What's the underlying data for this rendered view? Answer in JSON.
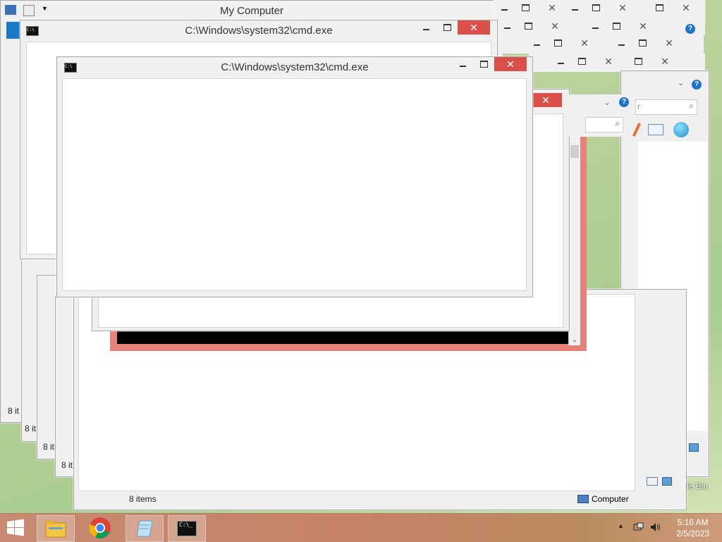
{
  "windows": {
    "explorer": {
      "title": "My Computer",
      "status_items": "8 items",
      "status_items_short": "8 it",
      "status_computer": "Computer",
      "status_computer_partial": "uter",
      "search_partial": "r"
    },
    "cmd_back": {
      "title": "C:\\Windows\\system32\\cmd.exe"
    },
    "cmd_front": {
      "title": "C:\\Windows\\system32\\cmd.exe"
    }
  },
  "desktop": {
    "recycle_bin_partial": "le Bin"
  },
  "taskbar": {
    "start_icon": "windows-logo-icon",
    "apps": [
      {
        "name": "file-explorer",
        "icon": "folder-icon"
      },
      {
        "name": "chrome",
        "icon": "chrome-icon"
      },
      {
        "name": "notepad",
        "icon": "notepad-icon"
      },
      {
        "name": "cmd",
        "icon": "cmd-icon",
        "label": "C:\\_"
      }
    ],
    "clock": {
      "time": "5:16 AM",
      "date": "2/5/2023"
    }
  },
  "colors": {
    "close_red": "#d9504a",
    "taskbar": "#c58266",
    "error_border": "#e8817a"
  }
}
